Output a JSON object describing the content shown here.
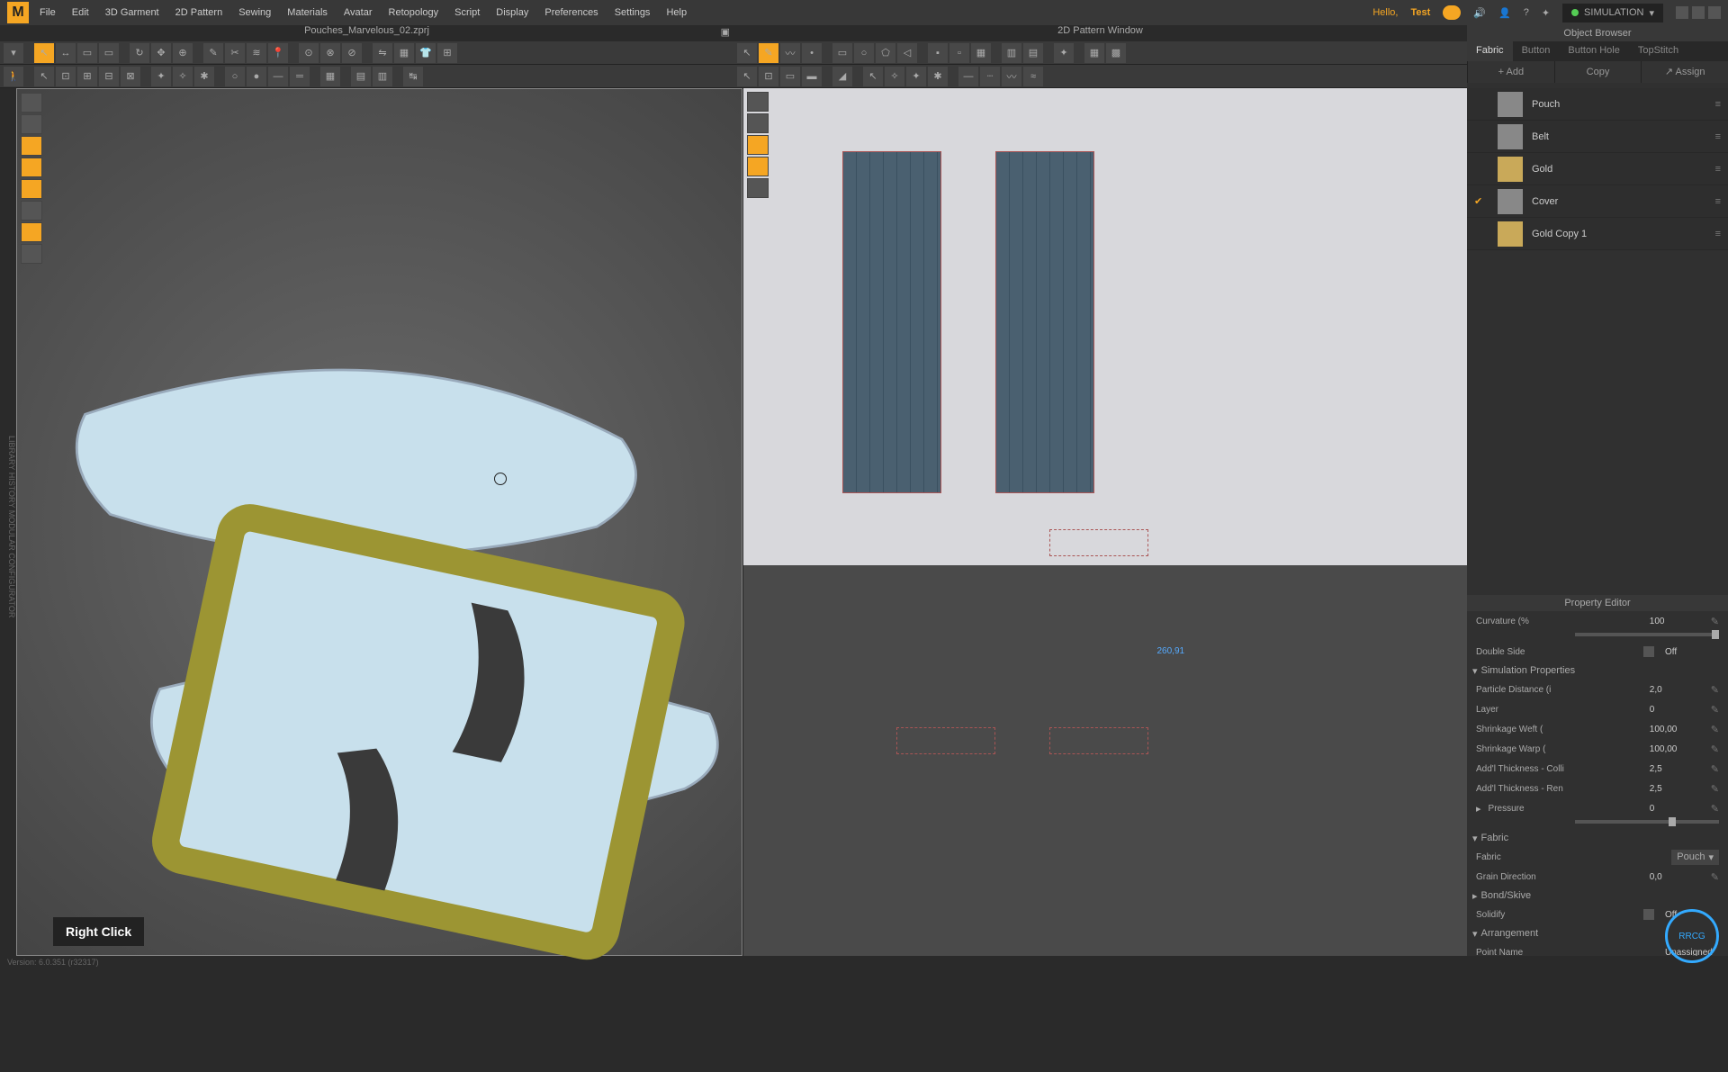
{
  "menubar": {
    "items": [
      "File",
      "Edit",
      "3D Garment",
      "2D Pattern",
      "Sewing",
      "Materials",
      "Avatar",
      "Retopology",
      "Script",
      "Display",
      "Preferences",
      "Settings",
      "Help"
    ],
    "hello": "Hello,",
    "user": "Test",
    "simulation": "SIMULATION"
  },
  "tabs": {
    "filename": "Pouches_Marvelous_02.zprj",
    "window2d": "2D Pattern Window"
  },
  "object_browser": {
    "title": "Object Browser",
    "tabs": [
      "Fabric",
      "Button",
      "Button Hole",
      "TopStitch"
    ],
    "actions": {
      "add": "Add",
      "copy": "Copy",
      "assign": "Assign"
    },
    "fabrics": [
      {
        "name": "Pouch",
        "swatch": "plain",
        "checked": false
      },
      {
        "name": "Belt",
        "swatch": "plain",
        "checked": false
      },
      {
        "name": "Gold",
        "swatch": "gold",
        "checked": false
      },
      {
        "name": "Cover",
        "swatch": "plain",
        "checked": true
      },
      {
        "name": "Gold Copy 1",
        "swatch": "gold",
        "checked": false
      }
    ]
  },
  "property_editor": {
    "title": "Property Editor",
    "curvature": {
      "label": "Curvature (%",
      "value": "100"
    },
    "double_side": {
      "label": "Double Side",
      "value": "Off"
    },
    "sections": {
      "simulation": "Simulation Properties",
      "fabric": "Fabric",
      "bond": "Bond/Skive",
      "arrangement": "Arrangement"
    },
    "particle_distance": {
      "label": "Particle Distance (i",
      "value": "2,0"
    },
    "layer": {
      "label": "Layer",
      "value": "0"
    },
    "shrink_weft": {
      "label": "Shrinkage Weft (",
      "value": "100,00"
    },
    "shrink_warp": {
      "label": "Shrinkage Warp (",
      "value": "100,00"
    },
    "thick_coll": {
      "label": "Add'l Thickness - Colli",
      "value": "2,5"
    },
    "thick_ren": {
      "label": "Add'l Thickness - Ren",
      "value": "2,5"
    },
    "pressure": {
      "label": "Pressure",
      "value": "0"
    },
    "fabric_sel": {
      "label": "Fabric",
      "value": "Pouch"
    },
    "grain": {
      "label": "Grain Direction",
      "value": "0,0"
    },
    "solidify": {
      "label": "Solidify",
      "value": "Off"
    },
    "point_name": {
      "label": "Point Name",
      "value": "Unassigned"
    }
  },
  "viewport_2d": {
    "coord": "260,91"
  },
  "click_indicator": "Right Click",
  "statusbar": "Version: 6.0.351 (r32317)",
  "left_rail": "LIBRARY   HISTORY   MODULAR CONFIGURATOR"
}
